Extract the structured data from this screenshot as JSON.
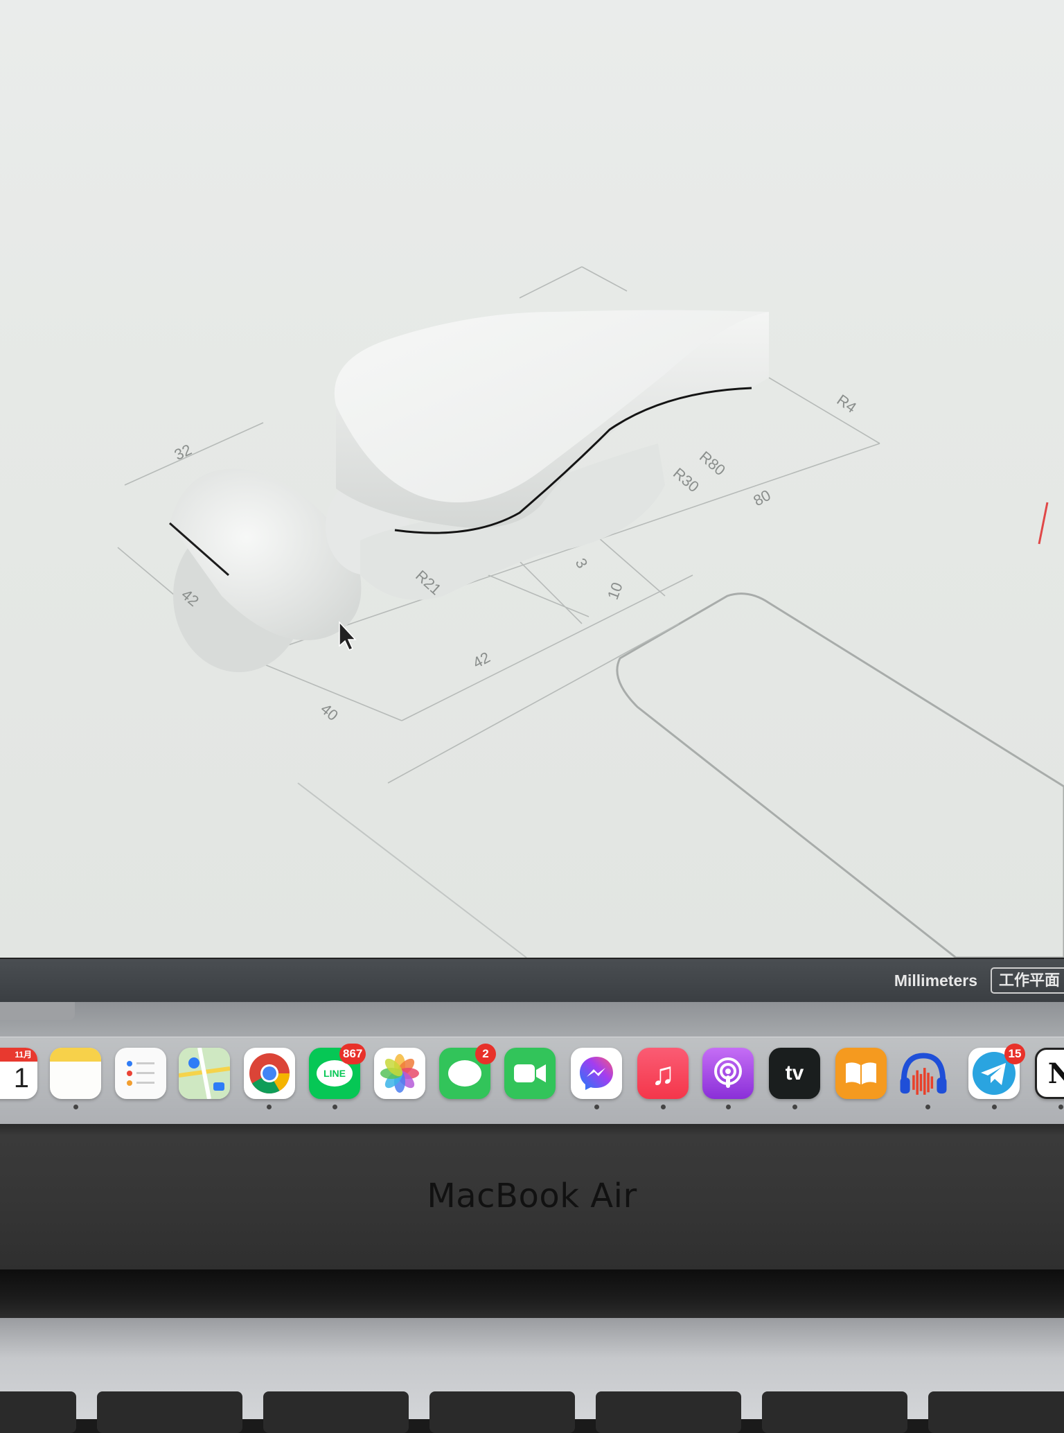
{
  "canvas": {
    "dimensions": [
      "32",
      "42",
      "42",
      "40",
      "R21",
      "R30",
      "R80",
      "80",
      "R4",
      "3",
      "10"
    ],
    "accent_line_color": "#e04848"
  },
  "statusbar": {
    "units": "Millimeters",
    "cplane": "工作平面"
  },
  "dock": {
    "apps": [
      {
        "name": "Calendar",
        "icon": "calendar-icon",
        "label_top": "11月",
        "label_day": "1",
        "running": false
      },
      {
        "name": "Notes",
        "icon": "notes-icon",
        "running": true
      },
      {
        "name": "Reminders",
        "icon": "reminders-icon",
        "running": false
      },
      {
        "name": "Maps",
        "icon": "maps-icon",
        "running": false
      },
      {
        "name": "Google Chrome",
        "icon": "chrome-icon",
        "running": true
      },
      {
        "name": "LINE",
        "icon": "line-icon",
        "text": "LINE",
        "badge": "867",
        "running": true
      },
      {
        "name": "Photos",
        "icon": "photos-icon",
        "running": false
      },
      {
        "name": "Messages",
        "icon": "messages-icon",
        "badge": "2",
        "running": false
      },
      {
        "name": "FaceTime",
        "icon": "facetime-icon",
        "running": false
      },
      {
        "name": "Messenger",
        "icon": "messenger-icon",
        "running": true
      },
      {
        "name": "Music",
        "icon": "music-icon",
        "running": true
      },
      {
        "name": "Podcasts",
        "icon": "podcasts-icon",
        "running": true
      },
      {
        "name": "Apple TV",
        "icon": "appletv-icon",
        "text": "tv",
        "running": true
      },
      {
        "name": "Books",
        "icon": "books-icon",
        "running": false
      },
      {
        "name": "Audacity",
        "icon": "audacity-icon",
        "running": true
      },
      {
        "name": "Telegram",
        "icon": "telegram-icon",
        "badge": "15",
        "running": true
      },
      {
        "name": "Notion",
        "icon": "notion-icon",
        "text": "N",
        "running": true
      }
    ]
  },
  "hardware": {
    "brand": "MacBook Air"
  }
}
